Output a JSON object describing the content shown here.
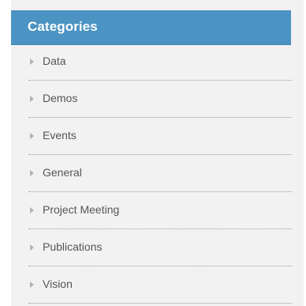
{
  "widget": {
    "title": "Categories",
    "items": [
      {
        "label": "Data"
      },
      {
        "label": "Demos"
      },
      {
        "label": "Events"
      },
      {
        "label": "General"
      },
      {
        "label": "Project Meeting"
      },
      {
        "label": "Publications"
      },
      {
        "label": "Vision"
      }
    ]
  },
  "colors": {
    "header_bg": "#4b93c2",
    "panel_bg": "#f2f2f2",
    "text": "#555555",
    "arrow": "#b3b3b3"
  },
  "icons": {
    "item_arrow": "caret-right-icon"
  }
}
